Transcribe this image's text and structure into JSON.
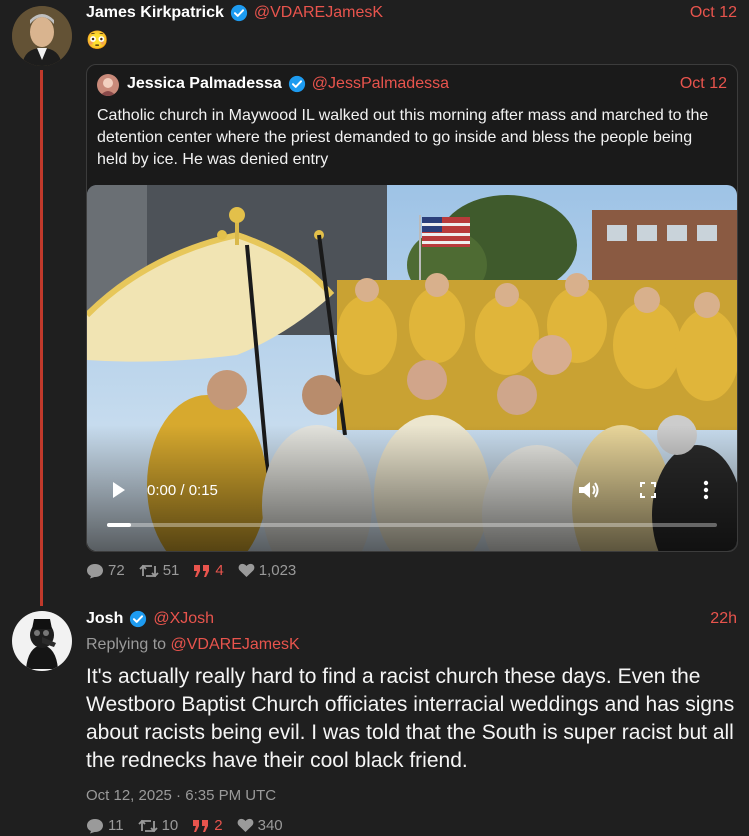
{
  "tweet1": {
    "name": "James Kirkpatrick",
    "handle": "@VDAREJamesK",
    "date": "Oct 12",
    "text": "😳",
    "stats": {
      "replies": "72",
      "retweets": "51",
      "quotes": "4",
      "likes": "1,023"
    }
  },
  "quote": {
    "name": "Jessica Palmadessa",
    "handle": "@JessPalmadessa",
    "date": "Oct 12",
    "text": "Catholic church in Maywood IL walked out this morning after mass and marched to the detention center where the priest demanded to go inside and bless the people being held by ice. He was denied entry",
    "video": {
      "time": "0:00 / 0:15",
      "progress": 0.04
    }
  },
  "tweet2": {
    "name": "Josh",
    "handle": "@XJosh",
    "date": "22h",
    "replying_prefix": "Replying to ",
    "replying_to": "@VDAREJamesK",
    "text": "It's actually really hard to find a racist church these days. Even the Westboro Baptist Church officiates interracial weddings and has signs about racists being evil. I was told that the South is super racist but all the rednecks have their cool black friend.",
    "timestamp": "Oct 12, 2025 · 6:35 PM UTC",
    "stats": {
      "replies": "11",
      "retweets": "10",
      "quotes": "2",
      "likes": "340"
    }
  },
  "colors": {
    "accent": "#e8544d",
    "verified": "#1d9bf0",
    "background": "#1f1f1f"
  },
  "icons": [
    "verified-badge-icon",
    "reply-icon",
    "retweet-icon",
    "quote-icon",
    "heart-icon",
    "play-icon",
    "volume-icon",
    "fullscreen-icon",
    "more-icon"
  ]
}
